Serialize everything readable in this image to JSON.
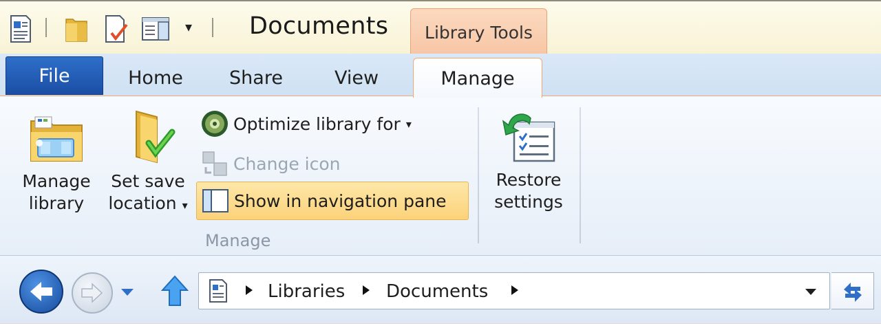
{
  "window": {
    "title": "Documents",
    "context_tab": "Library Tools"
  },
  "quick_access": {
    "items": [
      {
        "icon": "properties-icon"
      },
      {
        "icon": "new-folder-icon"
      },
      {
        "icon": "rename-icon"
      },
      {
        "icon": "layout-pane-icon"
      }
    ],
    "dropdown": "▾"
  },
  "tabs": {
    "file": "File",
    "home": "Home",
    "share": "Share",
    "view": "View",
    "manage": "Manage"
  },
  "ribbon": {
    "manage_library": [
      "Manage",
      "library"
    ],
    "set_save_location": [
      "Set save",
      "location"
    ],
    "optimize": "Optimize library for",
    "change_icon": "Change icon",
    "show_nav": "Show in navigation pane",
    "group_label": "Manage",
    "restore": [
      "Restore",
      "settings"
    ]
  },
  "address": {
    "crumbs": [
      "Libraries",
      "Documents"
    ]
  },
  "colors": {
    "file_tab": "#1b4ea5",
    "context_accent": "#f7c6a5",
    "selected_button": "#fcd27a"
  }
}
